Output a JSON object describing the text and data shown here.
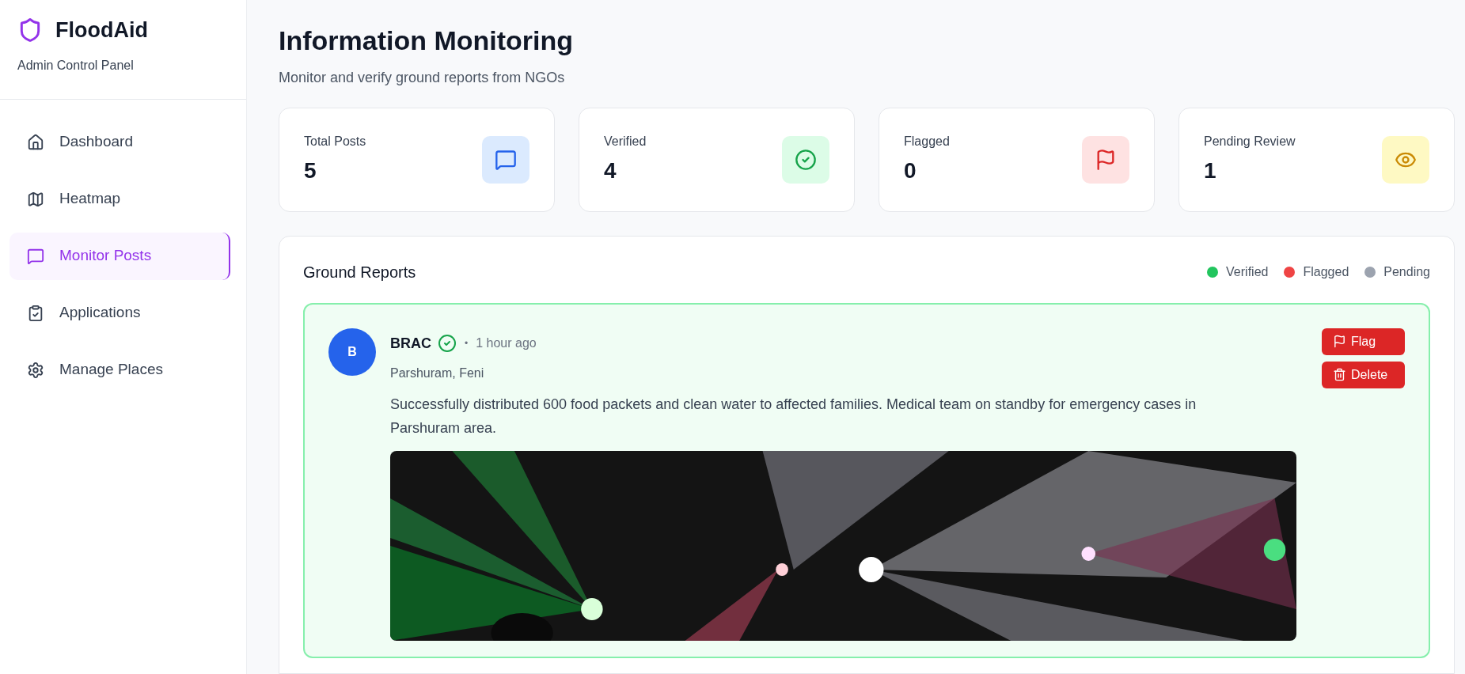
{
  "brand": {
    "name": "FloodAid",
    "subtitle": "Admin Control Panel"
  },
  "sidebar": {
    "items": [
      {
        "label": "Dashboard",
        "selected": false
      },
      {
        "label": "Heatmap",
        "selected": false
      },
      {
        "label": "Monitor Posts",
        "selected": true
      },
      {
        "label": "Applications",
        "selected": false
      },
      {
        "label": "Manage Places",
        "selected": false
      }
    ]
  },
  "header": {
    "title": "Information Monitoring",
    "subtitle": "Monitor and verify ground reports from NGOs"
  },
  "stats": [
    {
      "label": "Total Posts",
      "value": "5"
    },
    {
      "label": "Verified",
      "value": "4"
    },
    {
      "label": "Flagged",
      "value": "0"
    },
    {
      "label": "Pending Review",
      "value": "1"
    }
  ],
  "reports": {
    "title": "Ground Reports",
    "legend": [
      {
        "label": "Verified",
        "color": "#22c55e"
      },
      {
        "label": "Flagged",
        "color": "#ef4444"
      },
      {
        "label": "Pending",
        "color": "#9ca3af"
      }
    ],
    "posts": [
      {
        "kind": "verified",
        "avatar": "B",
        "author": "BRAC",
        "verified": true,
        "separator": "•",
        "time": "1 hour ago",
        "location": "Parshuram, Feni",
        "text": "Successfully distributed 600 food packets and clean water to affected families. Medical team on standby for emergency cases in Parshuram area.",
        "image": {
          "kind": "picture"
        },
        "actions": [
          {
            "label": "Flag"
          },
          {
            "label": "Delete"
          }
        ]
      }
    ]
  }
}
